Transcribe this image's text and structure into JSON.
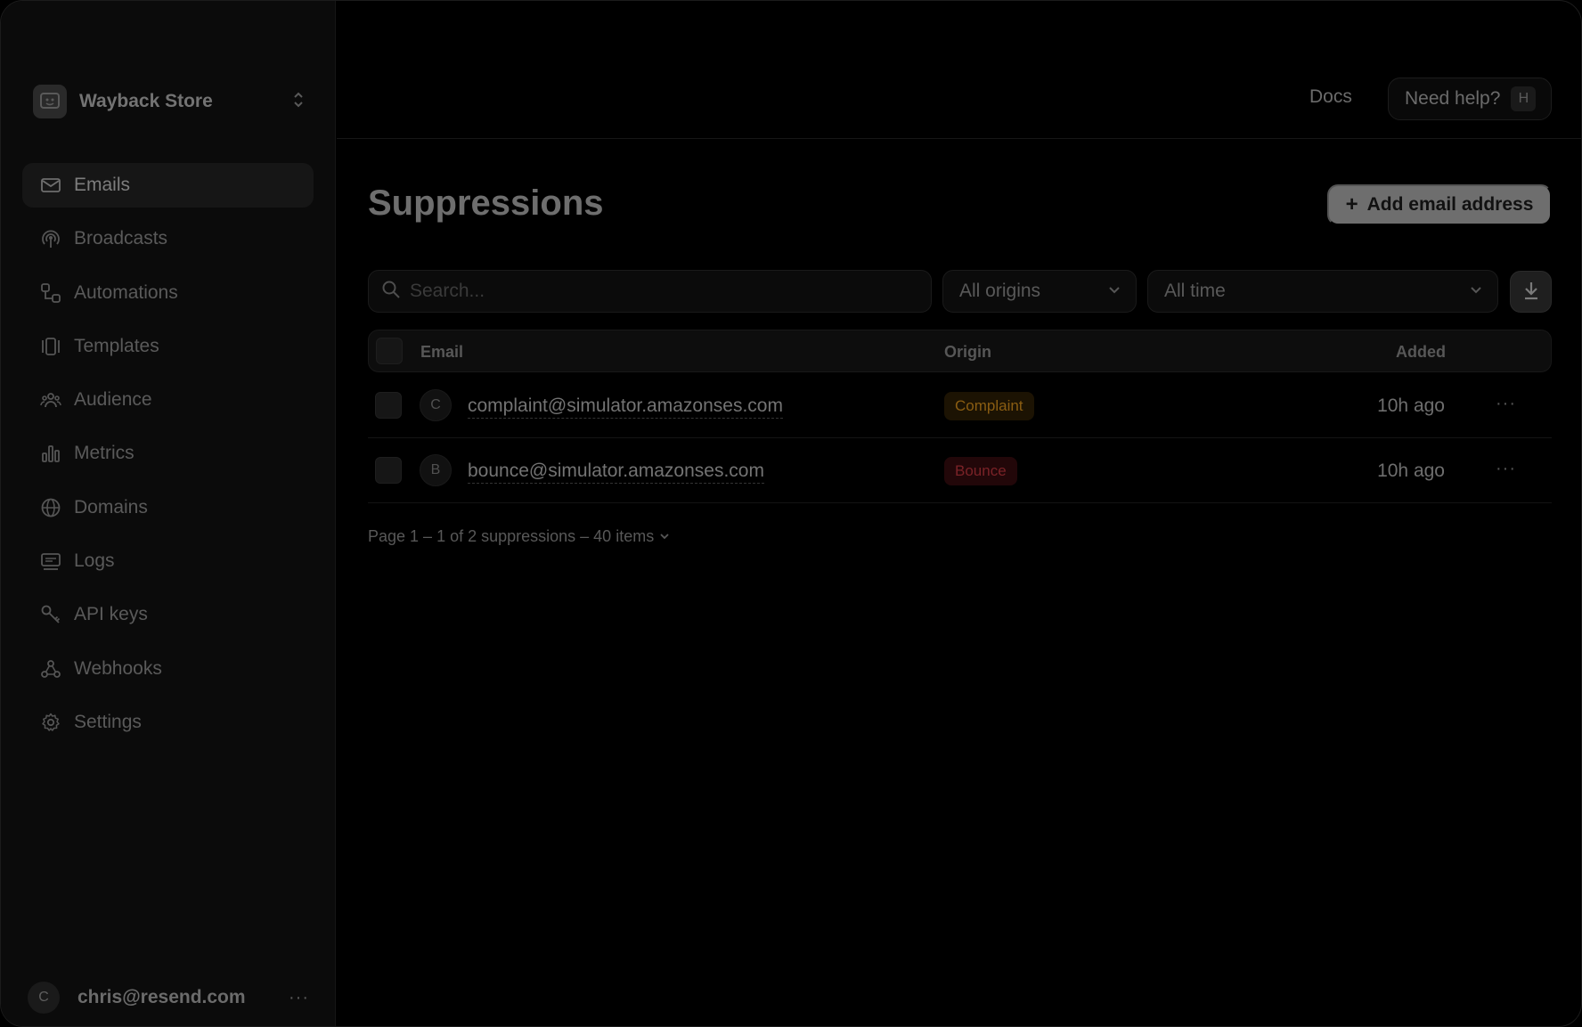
{
  "team": {
    "name": "Wayback Store"
  },
  "nav": [
    {
      "label": "Emails",
      "icon": "mail-icon",
      "active": true
    },
    {
      "label": "Broadcasts",
      "icon": "broadcast-icon"
    },
    {
      "label": "Automations",
      "icon": "automation-icon"
    },
    {
      "label": "Templates",
      "icon": "template-icon"
    },
    {
      "label": "Audience",
      "icon": "audience-icon"
    },
    {
      "label": "Metrics",
      "icon": "metrics-icon"
    },
    {
      "label": "Domains",
      "icon": "globe-icon"
    },
    {
      "label": "Logs",
      "icon": "logs-icon"
    },
    {
      "label": "API keys",
      "icon": "key-icon"
    },
    {
      "label": "Webhooks",
      "icon": "webhook-icon"
    },
    {
      "label": "Settings",
      "icon": "gear-icon"
    }
  ],
  "user": {
    "initial": "C",
    "email": "chris@resend.com",
    "more": "···"
  },
  "header": {
    "docs": "Docs",
    "help": "Need help?",
    "help_shortcut": "H"
  },
  "page": {
    "title": "Suppressions",
    "add_button": "Add email address",
    "add_icon": "+"
  },
  "filters": {
    "search_placeholder": "Search...",
    "origins": "All origins",
    "time": "All time"
  },
  "table": {
    "columns": {
      "email": "Email",
      "origin": "Origin",
      "added": "Added"
    },
    "rows": [
      {
        "initial": "C",
        "email": "complaint@simulator.amazonses.com",
        "origin": "Complaint",
        "added": "10h ago",
        "more": "···"
      },
      {
        "initial": "B",
        "email": "bounce@simulator.amazonses.com",
        "origin": "Bounce",
        "added": "10h ago",
        "more": "···"
      }
    ]
  },
  "pager": {
    "text": "Page 1 – 1 of 2 suppressions – 40 items"
  },
  "colors": {
    "complaint": "#8a5d12",
    "bounce": "#7a2227",
    "button": "#6e6e6e"
  }
}
